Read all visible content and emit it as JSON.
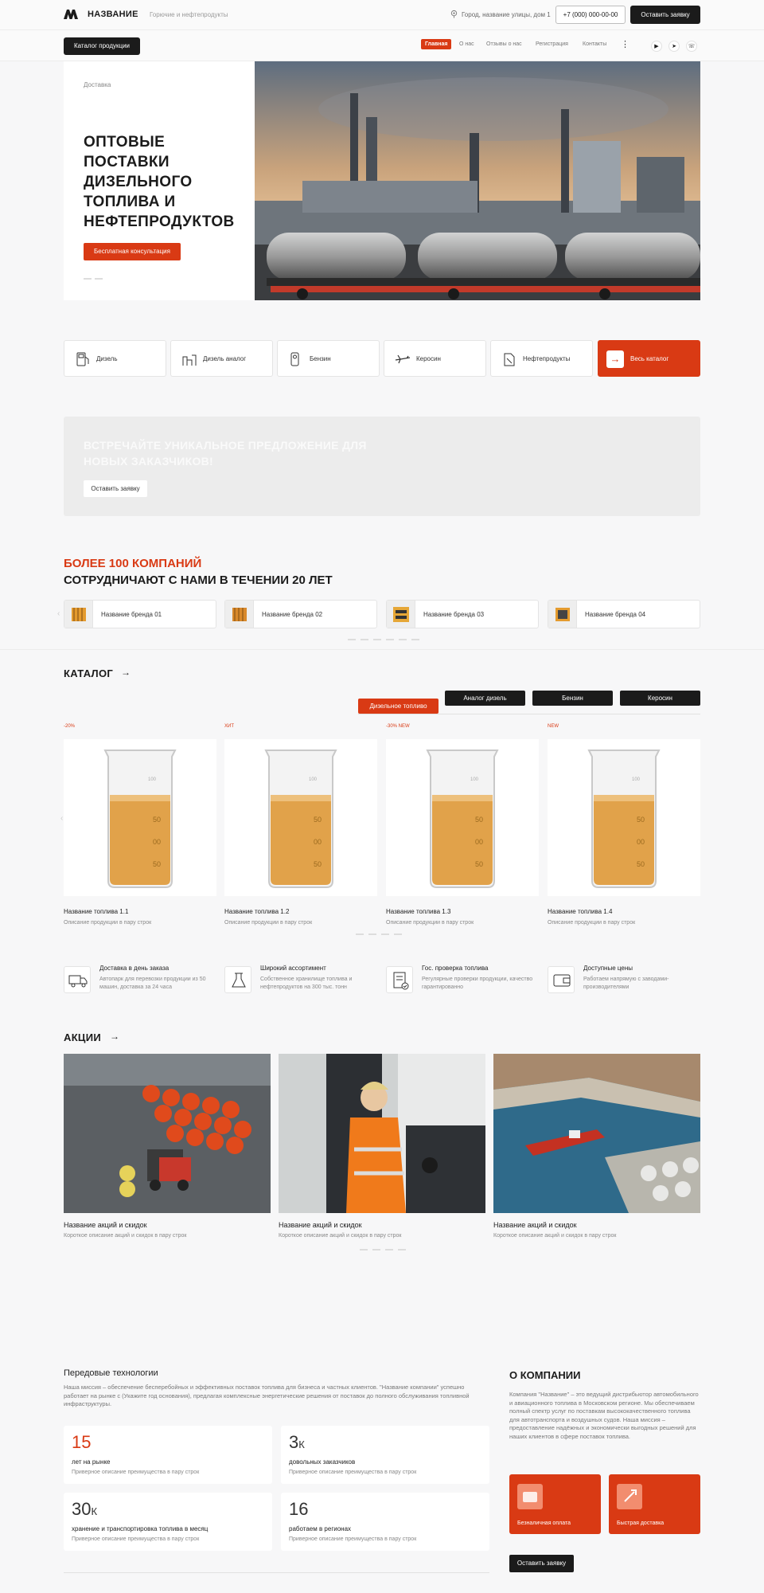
{
  "header": {
    "logo": "НАЗВАНИЕ",
    "subtitle": "Горючие и нефтепродукты",
    "address": "Город, название улицы, дом 1",
    "phone": "+7 (000) 000-00-00",
    "cta": "Оставить заявку"
  },
  "nav": {
    "catalog_btn": "Каталог продукции",
    "items": [
      "Главная",
      "О нас",
      "Отзывы о нас",
      "Регистрация",
      "Контакты"
    ],
    "more": "⋮"
  },
  "hero": {
    "crumb": "Доставка",
    "title": "ОПТОВЫЕ ПОСТАВКИ ДИЗЕЛЬНОГО ТОПЛИВА И НЕФТЕПРОДУКТОВ",
    "button": "Бесплатная консультация"
  },
  "categories": [
    "Дизель",
    "Дизель аналог",
    "Бензин",
    "Керосин",
    "Нефтепродукты"
  ],
  "categories_all": "Весь каталог",
  "promo": {
    "title": "ВСТРЕЧАЙТЕ УНИКАЛЬНОЕ ПРЕДЛОЖЕНИЕ ДЛЯ НОВЫХ ЗАКАЗЧИКОВ!",
    "button": "Оставить заявку"
  },
  "partners": {
    "title_red": "БОЛЕЕ 100 КОМПАНИЙ",
    "title": "СОТРУДНИЧАЮТ С НАМИ В ТЕЧЕНИИ 20 ЛЕТ",
    "brands": [
      "Название бренда 01",
      "Название бренда 02",
      "Название бренда 03",
      "Название бренда 04"
    ]
  },
  "catalog": {
    "title": "КАТАЛОГ",
    "tabs": [
      "Дизельное топливо",
      "Аналог дизель",
      "Бензин",
      "Керосин"
    ],
    "products": [
      {
        "badges": "-20%",
        "name": "Название топлива 1.1",
        "desc": "Описание продукции в пару строк"
      },
      {
        "badges": "ХИТ",
        "name": "Название топлива 1.2",
        "desc": "Описание продукции в пару строк"
      },
      {
        "badges": "-30%    NEW",
        "name": "Название топлива 1.3",
        "desc": "Описание продукции в пару строк"
      },
      {
        "badges": "NEW",
        "name": "Название топлива 1.4",
        "desc": "Описание продукции в пару строк"
      }
    ]
  },
  "features": [
    {
      "title": "Доставка в день заказа",
      "desc": "Автопарк для перевозки продукции из 50 машин, доставка за 24 часа"
    },
    {
      "title": "Широкий ассортимент",
      "desc": "Собственное хранилище топлива и нефтепродуктов на 300 тыс. тонн"
    },
    {
      "title": "Гос. проверка топлива",
      "desc": "Регулярные проверки продукции, качество гарантированно"
    },
    {
      "title": "Доступные цены",
      "desc": "Работаем напрямую с заводами-производителями"
    }
  ],
  "actions": {
    "title": "АКЦИИ",
    "items": [
      {
        "name": "Название акций и скидок",
        "desc": "Короткое описание акций и скидок в пару строк"
      },
      {
        "name": "Название акций и скидок",
        "desc": "Короткое описание акций и скидок в пару строк"
      },
      {
        "name": "Название акций и скидок",
        "desc": "Короткое описание акций и скидок в пару строк"
      }
    ]
  },
  "tech": {
    "title": "Передовые технологии",
    "text": "Наша миссия – обеспечение бесперебойных и эффективных поставок топлива для бизнеса и частных клиентов. \"Название компании\" успешно работает на рынке с (Укажите год основания), предлагая комплексные энергетические решения от поставок до полного обслуживания топливной инфраструктуры.",
    "stats": [
      {
        "num": "15",
        "unit": "",
        "label": "лет на рынке",
        "desc": "Приверное описание преимущества в пару строк"
      },
      {
        "num": "3",
        "unit": "К",
        "label": "довольных заказчиков",
        "desc": "Приверное описание преимущества в пару строк"
      },
      {
        "num": "30",
        "unit": "К",
        "label": "хранение и транспортировка топлива в месяц",
        "desc": "Приверное описание преимущества в пару строк"
      },
      {
        "num": "16",
        "unit": "",
        "label": "работаем в регионах",
        "desc": "Приверное описание преимущества в пару строк"
      }
    ]
  },
  "about": {
    "title": "О КОМПАНИИ",
    "text": "Компания \"Название\" – это ведущий дистрибьютор автомобильного и авиационного топлива в Московском регионе. Мы обеспечиваем полный спектр услуг по поставкам высококачественного топлива для автотранспорта и воздушных судов. Наша миссия – предоставление надёжных и экономически выгодных решений для наших клиентов в сфере поставок топлива.",
    "cards": [
      "Безналичная оплата",
      "Быстрая доставка"
    ],
    "button": "Оставить заявку"
  },
  "colors": {
    "accent": "#d93a14",
    "dark": "#1b1b1b",
    "bg": "#f7f7f8"
  }
}
